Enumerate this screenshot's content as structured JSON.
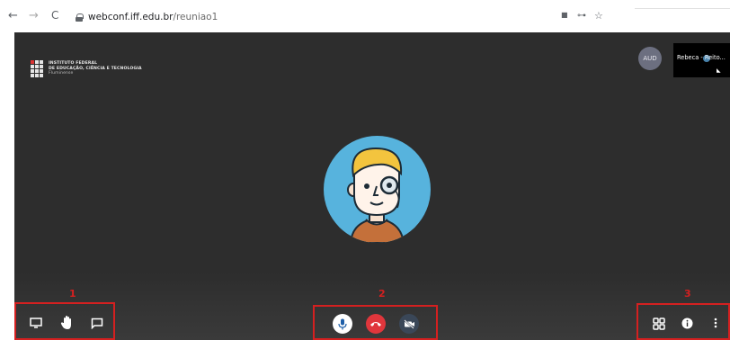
{
  "browser": {
    "url_domain": "webconf.iff.edu.br",
    "url_path": "/reuniao1",
    "back_icon": "arrow-left-icon",
    "forward_icon": "arrow-right-icon",
    "reload_icon": "reload-icon"
  },
  "logo": {
    "line1": "INSTITUTO FEDERAL",
    "line2": "DE EDUCAÇÃO, CIÊNCIA E TECNOLOGIA",
    "line3": "Fluminense"
  },
  "participant_avatar_initials": "AUD",
  "thumbnail": {
    "name": "Rebeca - Reito..."
  },
  "annotations": {
    "group1": "1",
    "group2": "2",
    "group3": "3"
  },
  "toolbar": {
    "left": [
      "screen-share-icon",
      "raise-hand-icon",
      "chat-icon"
    ],
    "center": [
      "microphone-icon",
      "hangup-icon",
      "camera-off-icon"
    ],
    "right": [
      "tile-view-icon",
      "info-icon",
      "more-options-icon"
    ]
  },
  "colors": {
    "annotation_red": "#d42020",
    "stage_bg": "#2d2d2d",
    "hangup_red": "#e0363c",
    "avatar_blue": "#57b3dd"
  }
}
